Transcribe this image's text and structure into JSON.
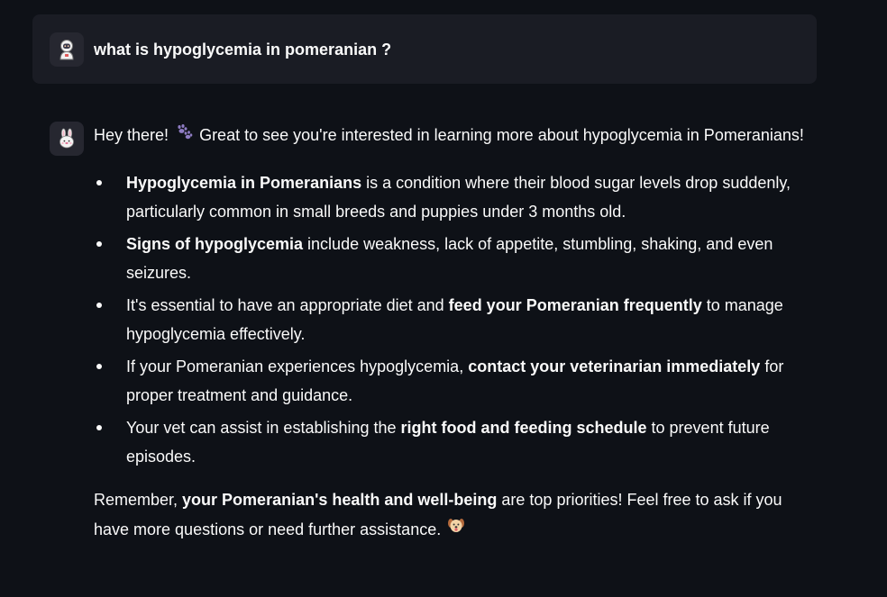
{
  "user_message": {
    "avatar_icon": "astronaut-avatar-icon",
    "text": "what is hypoglycemia in pomeranian ?"
  },
  "assistant_message": {
    "avatar_icon": "bunny-avatar-icon",
    "intro_part1": "Hey there! ",
    "intro_emoji": "paw-prints-icon",
    "intro_part2": " Great to see you're interested in learning more about hypoglycemia in Pomeranians!",
    "bullets": [
      {
        "bold1": "Hypoglycemia in Pomeranians",
        "text1": " is a condition where their blood sugar levels drop suddenly, particularly common in small breeds and puppies under 3 months old."
      },
      {
        "bold1": "Signs of hypoglycemia",
        "text1": " include weakness, lack of appetite, stumbling, shaking, and even seizures."
      },
      {
        "text0": "It's essential to have an appropriate diet and ",
        "bold1": "feed your Pomeranian frequently",
        "text1": " to manage hypoglycemia effectively."
      },
      {
        "text0": "If your Pomeranian experiences hypoglycemia, ",
        "bold1": "contact your veterinarian immediately",
        "text1": " for proper treatment and guidance."
      },
      {
        "text0": "Your vet can assist in establishing the ",
        "bold1": "right food and feeding schedule",
        "text1": " to prevent future episodes."
      }
    ],
    "closing_part1": "Remember, ",
    "closing_bold": "your Pomeranian's health and well-being",
    "closing_part2": " are top priorities! Feel free to ask if you have more questions or need further assistance. ",
    "closing_emoji": "dog-face-icon"
  },
  "colors": {
    "background": "#0e1117",
    "user_message_bg": "#1a1c24",
    "avatar_bg": "#262730",
    "text": "#fafafa"
  }
}
